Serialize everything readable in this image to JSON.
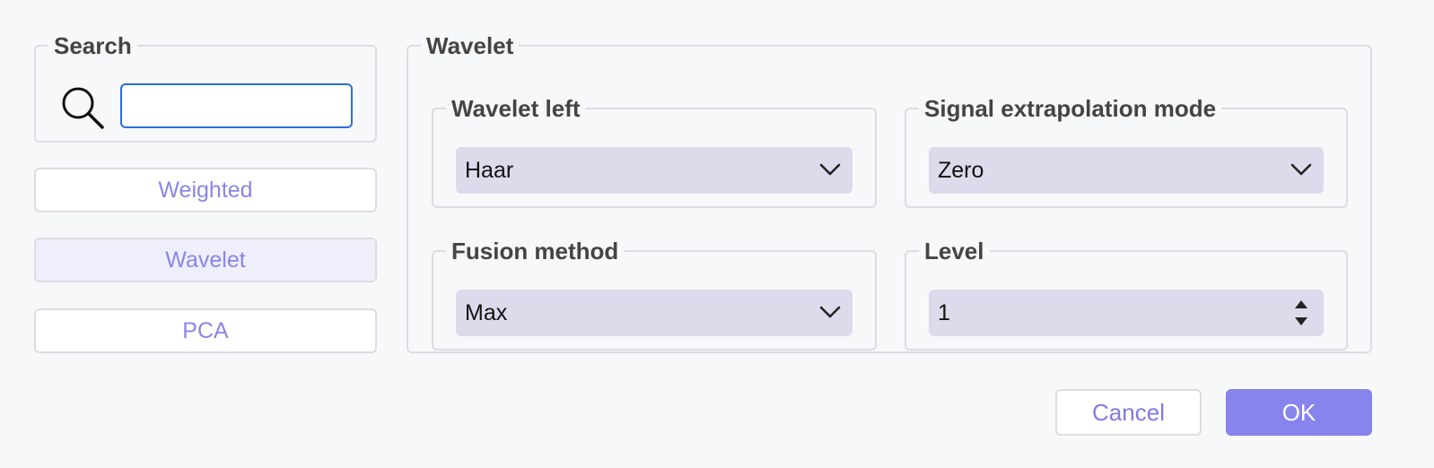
{
  "search": {
    "legend": "Search",
    "input_value": ""
  },
  "methods": [
    {
      "label": "Weighted",
      "active": false
    },
    {
      "label": "Wavelet",
      "active": true
    },
    {
      "label": "PCA",
      "active": false
    }
  ],
  "wavelet_panel": {
    "legend": "Wavelet",
    "wavelet_left": {
      "legend": "Wavelet left",
      "value": "Haar"
    },
    "signal_mode": {
      "legend": "Signal extrapolation mode",
      "value": "Zero"
    },
    "fusion_method": {
      "legend": "Fusion method",
      "value": "Max"
    },
    "level": {
      "legend": "Level",
      "value": "1"
    }
  },
  "footer": {
    "cancel_label": "Cancel",
    "ok_label": "OK"
  },
  "colors": {
    "accent": "#8784ee",
    "focus": "#2a6fd8",
    "combo_bg": "#dcdbeb"
  }
}
